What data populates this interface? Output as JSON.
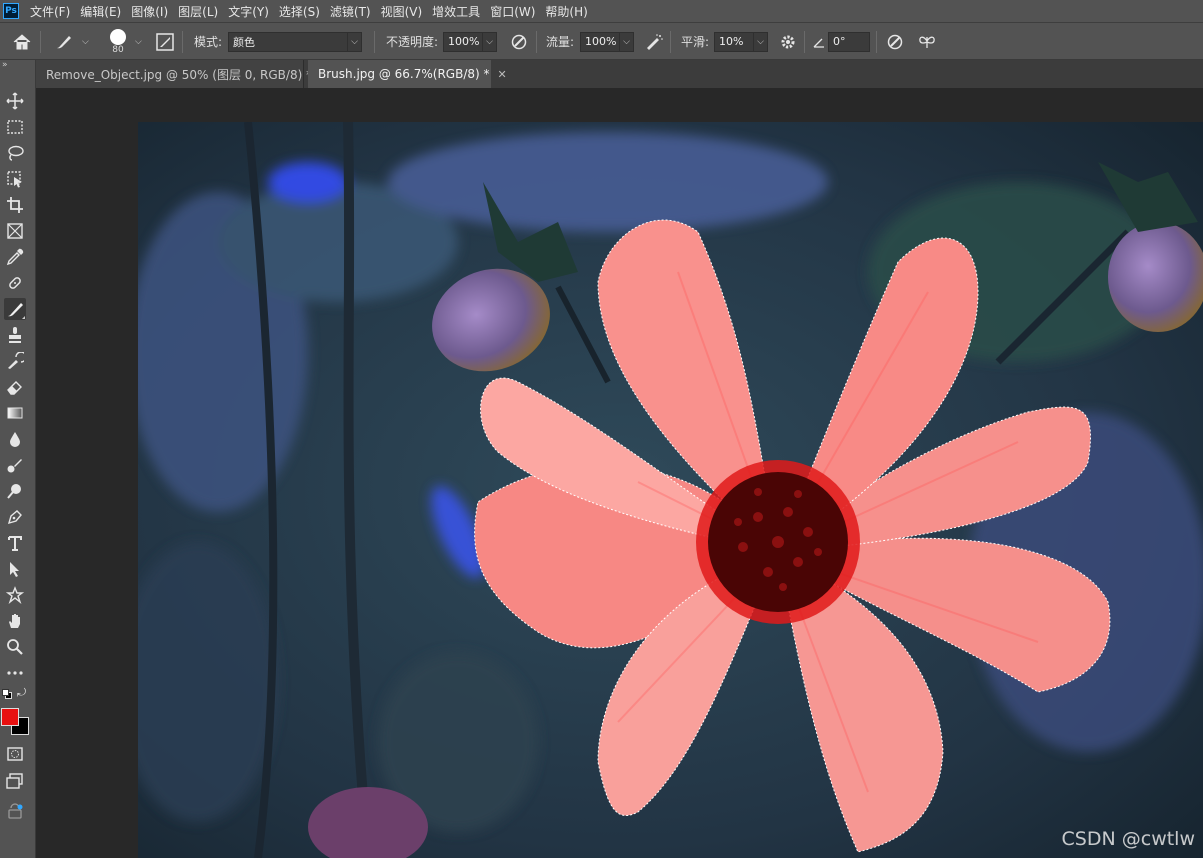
{
  "app": {
    "logo": "Ps"
  },
  "menu": [
    "文件(F)",
    "编辑(E)",
    "图像(I)",
    "图层(L)",
    "文字(Y)",
    "选择(S)",
    "滤镜(T)",
    "视图(V)",
    "增效工具",
    "窗口(W)",
    "帮助(H)"
  ],
  "options": {
    "brush_size": "80",
    "mode_label": "模式:",
    "mode_value": "颜色",
    "opacity_label": "不透明度:",
    "opacity_value": "100%",
    "flow_label": "流量:",
    "flow_value": "100%",
    "smoothing_label": "平滑:",
    "smoothing_value": "10%",
    "angle_value": "0°"
  },
  "tabs": [
    {
      "title": "Remove_Object.jpg @ 50% (图层 0, RGB/8) *",
      "active": false
    },
    {
      "title": "Brush.jpg @ 66.7%(RGB/8) *",
      "active": true
    }
  ],
  "colors": {
    "foreground": "#e81010",
    "background": "#000000",
    "flower": "#f26f6f"
  },
  "watermark": "CSDN @cwtlw"
}
